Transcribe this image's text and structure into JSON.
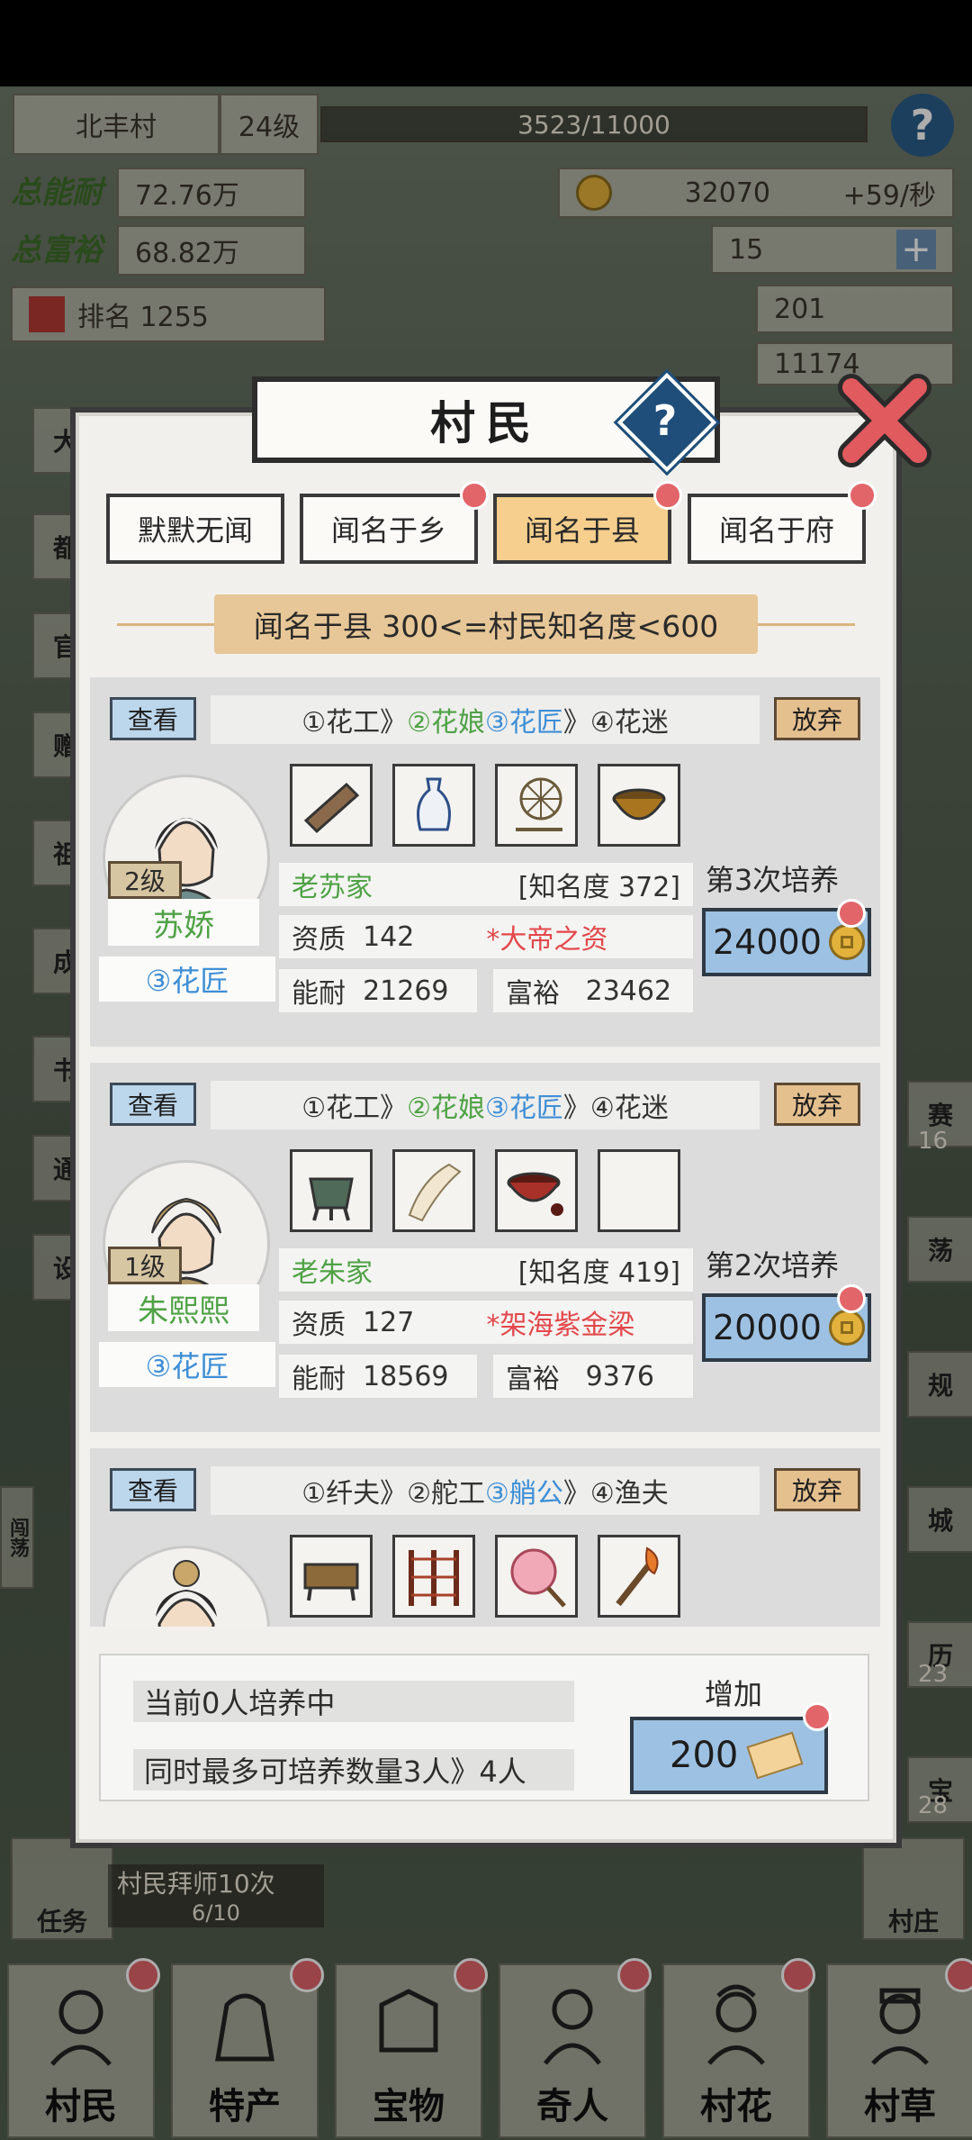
{
  "hud": {
    "village_name": "北丰村",
    "level": "24级",
    "exp": "3523/11000",
    "total_ability_label": "总能耐",
    "total_ability": "72.76万",
    "total_wealth_label": "总富裕",
    "total_wealth": "68.82万",
    "rank": "排名 1255",
    "coins": "32070",
    "coin_rate": "+59/秒",
    "gold": "15",
    "tickets": "201",
    "silver": "11174",
    "task_banner": "村民拜师10次",
    "task_progress": "6/10"
  },
  "left_side_buttons": [
    "大",
    "都",
    "官",
    "赠",
    "祖",
    "成",
    "书",
    "通",
    "设"
  ],
  "right_side_buttons": [
    "赛",
    "荡",
    "规",
    "城",
    "历",
    "宝"
  ],
  "right_side_counts": [
    "16",
    "23",
    "28"
  ],
  "left_mini_tag": "闯荡",
  "bottom_nav": [
    {
      "label": "任务"
    },
    {
      "label": "村庄"
    }
  ],
  "nav_tabs": [
    {
      "label": "村民"
    },
    {
      "label": "特产"
    },
    {
      "label": "宝物"
    },
    {
      "label": "奇人"
    },
    {
      "label": "村花"
    },
    {
      "label": "村草"
    }
  ],
  "modal": {
    "title": "村民",
    "help": "?",
    "tabs": [
      {
        "label": "默默无闻",
        "active": false,
        "dot": false
      },
      {
        "label": "闻名于乡",
        "active": false,
        "dot": true
      },
      {
        "label": "闻名于县",
        "active": true,
        "dot": true
      },
      {
        "label": "闻名于府",
        "active": false,
        "dot": true
      }
    ],
    "filter": "闻名于县  300<=村民知名度<600",
    "view_label": "查看",
    "giveup_label": "放弃",
    "villagers": [
      {
        "path": [
          "①花工",
          "》",
          "②花娘",
          "③花匠",
          "》",
          "④花迷"
        ],
        "level": "2级",
        "name": "苏娇",
        "title": "③花匠",
        "family": "老苏家",
        "fame": "[知名度 372]",
        "aptitude_label": "资质",
        "aptitude": "142",
        "trait": "*大帝之资",
        "ability_label": "能耐",
        "ability": "21269",
        "wealth_label": "富裕",
        "wealth": "23462",
        "train_label": "第3次培养",
        "cost": "24000",
        "items": [
          "abacus-icon",
          "porcelain-vase-icon",
          "spinning-wheel-icon",
          "lacquer-bowl-icon"
        ]
      },
      {
        "path": [
          "①花工",
          "》",
          "②花娘",
          "③花匠",
          "》",
          "④花迷"
        ],
        "level": "1级",
        "name": "朱熙熙",
        "title": "③花匠",
        "family": "老朱家",
        "fame": "[知名度 419]",
        "aptitude_label": "资质",
        "aptitude": "127",
        "trait": "*架海紫金梁",
        "ability_label": "能耐",
        "ability": "18569",
        "wealth_label": "富裕",
        "wealth": "9376",
        "train_label": "第2次培养",
        "cost": "20000",
        "items": [
          "bronze-ding-icon",
          "bamboo-slips-icon",
          "red-bowl-icon",
          "empty-slot"
        ]
      },
      {
        "path": [
          "①纤夫",
          "》",
          "②舵工",
          "③艄公",
          "》",
          "④渔夫"
        ],
        "items": [
          "wooden-tray-icon",
          "folding-screen-icon",
          "flower-fan-icon",
          "torch-icon"
        ]
      }
    ],
    "info_current": "当前0人培养中",
    "info_max": "同时最多可培养数量3人》4人",
    "add_label": "增加",
    "add_cost": "200"
  },
  "colors": {
    "green": "#4fa245",
    "blue": "#3f8fd6",
    "red": "#e3474b",
    "active_tab": "#f6cf8e",
    "button_blue": "#9dc1e2"
  }
}
